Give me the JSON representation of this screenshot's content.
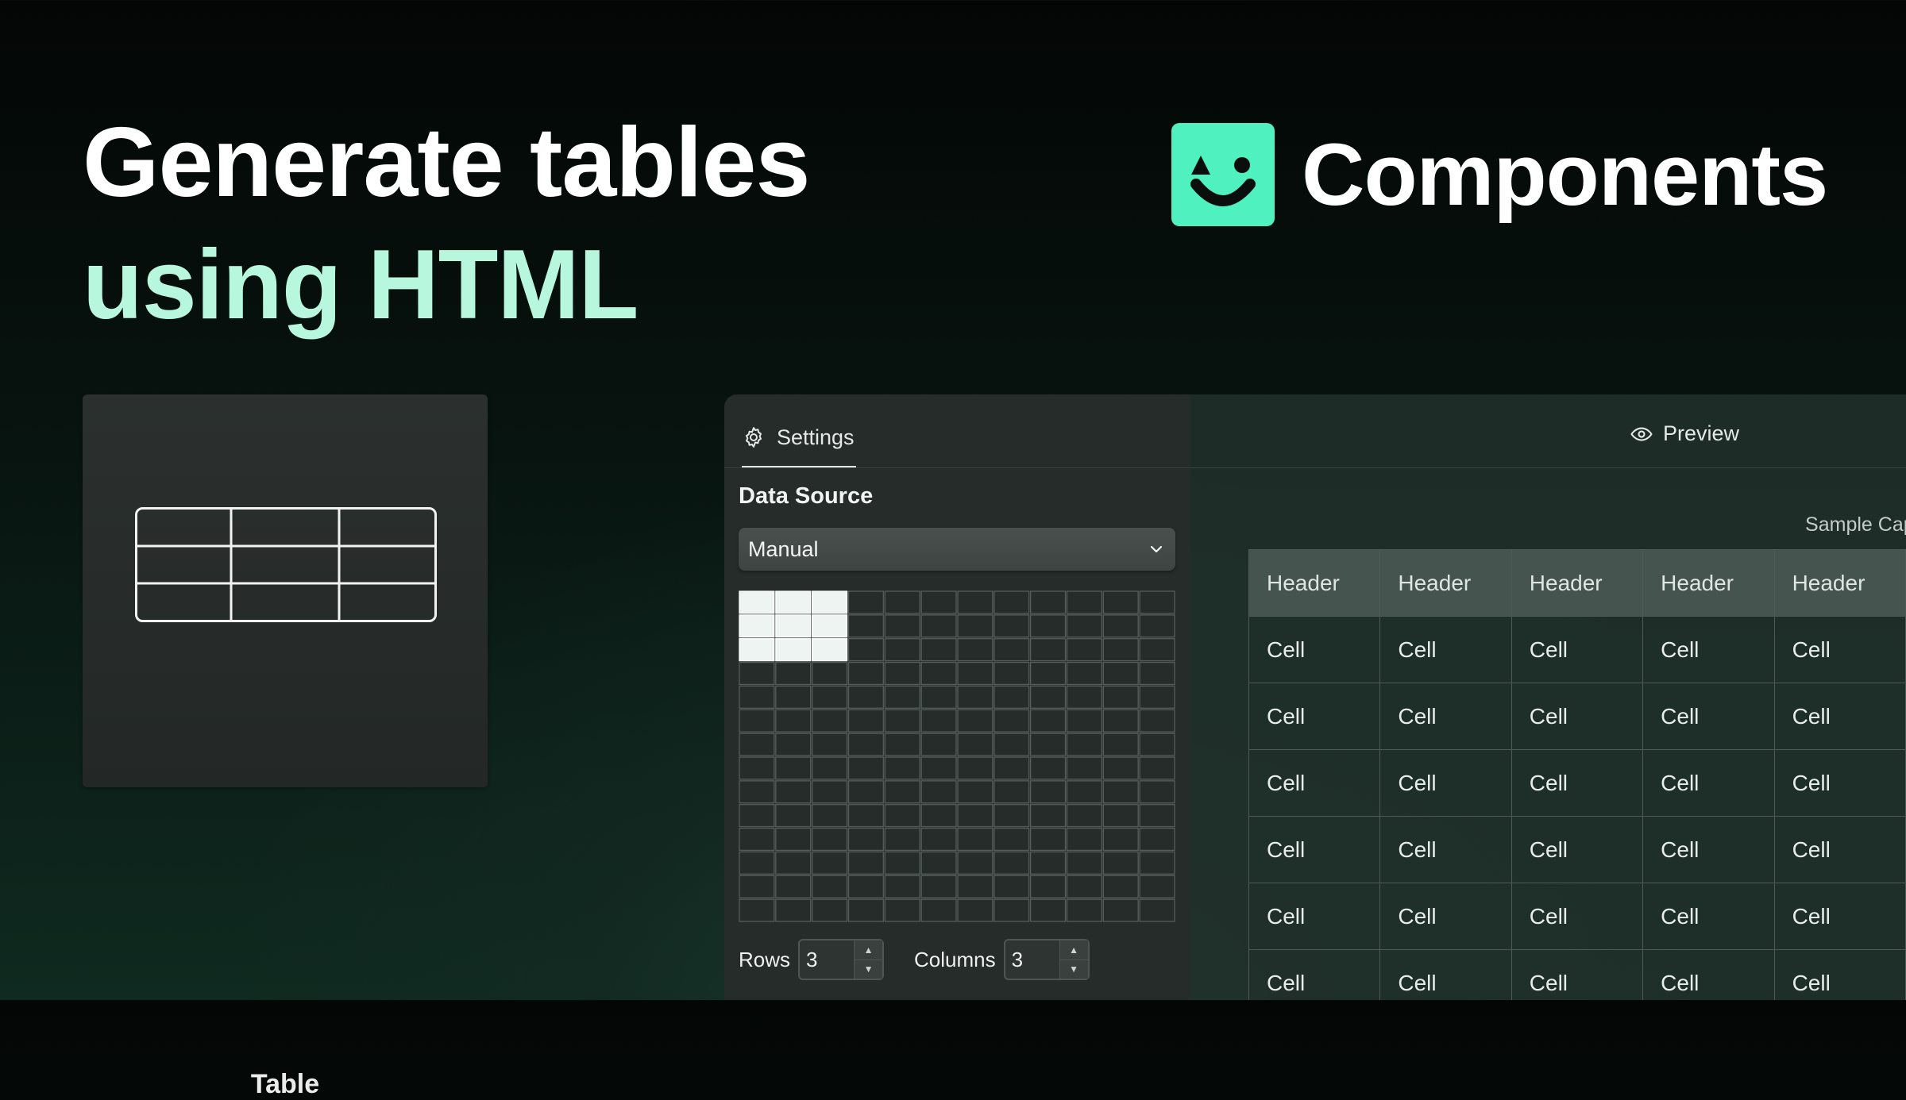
{
  "hero": {
    "line1": "Generate tables",
    "line2": "using HTML"
  },
  "brand": {
    "name": "Components",
    "logo_icon": "smiley-face-icon",
    "logo_color": "#4ff2bf"
  },
  "component_card": {
    "label": "Table",
    "icon": "table-grid-icon"
  },
  "settings": {
    "tab_label": "Settings",
    "tab_icon": "gear-icon",
    "data_source_title": "Data Source",
    "data_source_value": "Manual",
    "rows_label": "Rows",
    "rows_value": "3",
    "columns_label": "Columns",
    "columns_value": "3",
    "grid_picker": {
      "total_rows": 14,
      "total_columns": 12,
      "selected_rows": 3,
      "selected_columns": 3
    }
  },
  "preview": {
    "tab_label": "Preview",
    "tab_icon": "eye-icon",
    "caption": "Sample Caption",
    "headers": [
      "Header",
      "Header",
      "Header",
      "Header",
      "Header"
    ],
    "rows": [
      [
        "Cell",
        "Cell",
        "Cell",
        "Cell",
        "Cell"
      ],
      [
        "Cell",
        "Cell",
        "Cell",
        "Cell",
        "Cell"
      ],
      [
        "Cell",
        "Cell",
        "Cell",
        "Cell",
        "Cell"
      ],
      [
        "Cell",
        "Cell",
        "Cell",
        "Cell",
        "Cell"
      ],
      [
        "Cell",
        "Cell",
        "Cell",
        "Cell",
        "Cell"
      ],
      [
        "Cell",
        "Cell",
        "Cell",
        "Cell",
        "Cell"
      ]
    ]
  },
  "colors": {
    "accent": "#4ff2bf",
    "headline_secondary": "#b6f7dd"
  }
}
